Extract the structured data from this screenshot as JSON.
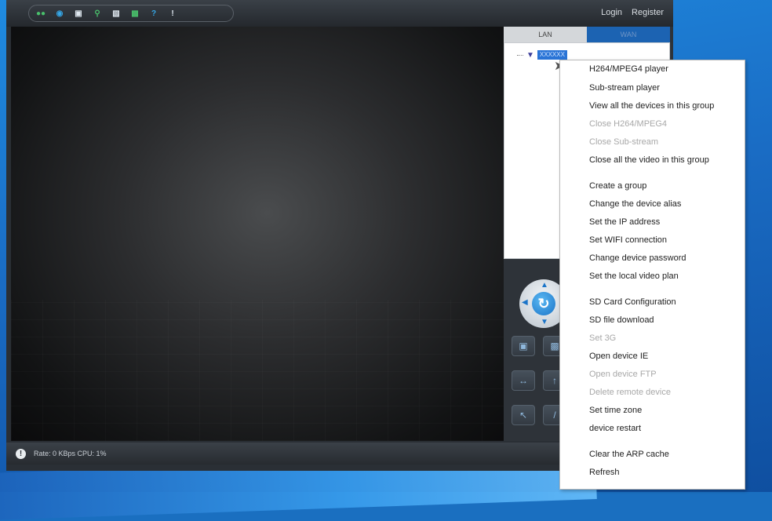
{
  "auth": {
    "login_label": "Login",
    "register_label": "Register"
  },
  "toolbar": {
    "icons": [
      "people-icon",
      "globe-icon",
      "camera-icon",
      "search-icon",
      "lock-icon",
      "monitor-icon",
      "help-icon",
      "info-icon"
    ]
  },
  "panel": {
    "tabs": [
      "LAN",
      "WAN"
    ],
    "device_id": "XXXXXX"
  },
  "status": {
    "text": "Rate: 0 KBps CPU: 1%"
  },
  "colors": {
    "menu_disabled": "#a8a8a8",
    "selection": "#2a74d6",
    "tab_wan": "#1c63b2"
  },
  "menu": {
    "items": [
      {
        "label": "H264/MPEG4 player",
        "disabled": false
      },
      {
        "label": "Sub-stream player",
        "disabled": false
      },
      {
        "label": "View all the devices in this group",
        "disabled": false
      },
      {
        "label": "Close H264/MPEG4",
        "disabled": true
      },
      {
        "label": "Close Sub-stream",
        "disabled": true
      },
      {
        "label": "Close all the video in this group",
        "disabled": false
      },
      {
        "label": "Create a group",
        "disabled": false
      },
      {
        "label": "Change the device alias",
        "disabled": false
      },
      {
        "label": "Set the IP address",
        "disabled": false
      },
      {
        "label": "Set WIFI connection",
        "disabled": false
      },
      {
        "label": "Change device password",
        "disabled": false
      },
      {
        "label": "Set the local video plan",
        "disabled": false
      },
      {
        "label": "SD Card Configuration",
        "disabled": false
      },
      {
        "label": "SD file download",
        "disabled": false
      },
      {
        "label": "Set 3G",
        "disabled": true
      },
      {
        "label": "Open device IE",
        "disabled": false
      },
      {
        "label": "Open device FTP",
        "disabled": true
      },
      {
        "label": "Delete remote device",
        "disabled": true
      },
      {
        "label": "Set time zone",
        "disabled": false
      },
      {
        "label": "device restart",
        "disabled": false
      },
      {
        "label": "Clear the ARP cache",
        "disabled": false
      },
      {
        "label": "Refresh",
        "disabled": false
      }
    ]
  }
}
